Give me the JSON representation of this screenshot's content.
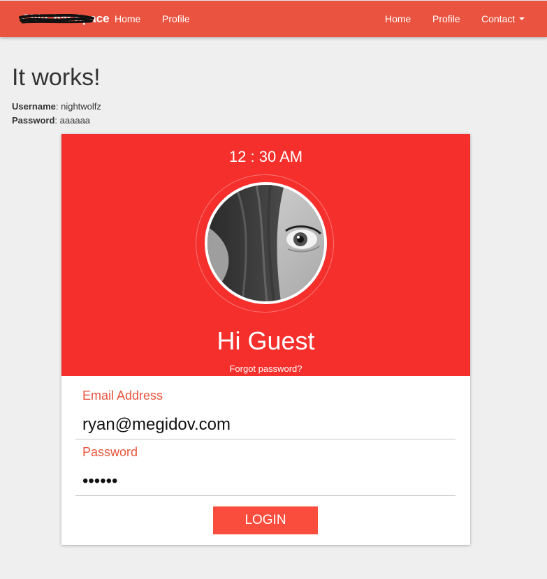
{
  "navbar": {
    "brand": "ChitChat Space",
    "left_links": [
      "Home",
      "Profile"
    ],
    "right_links": [
      "Home",
      "Profile"
    ],
    "contact_label": "Contact"
  },
  "main": {
    "heading": "It works!",
    "username_label": "Username",
    "username_value": ": nightwolfz",
    "password_label": "Password",
    "password_value": ": aaaaaa"
  },
  "card": {
    "clock": "12 : 30 AM",
    "greeting": "Hi Guest",
    "forgot_password": "Forgot password?",
    "email_label": "Email Address",
    "email_value": "ryan@megidov.com",
    "password_label": "Password",
    "password_value": "aaaaaa",
    "login_label": "LOGIN"
  },
  "colors": {
    "navbar": "#e95340",
    "card_header": "#f52f2b",
    "accent": "#e8553e",
    "login_button": "#fb4d3d"
  }
}
